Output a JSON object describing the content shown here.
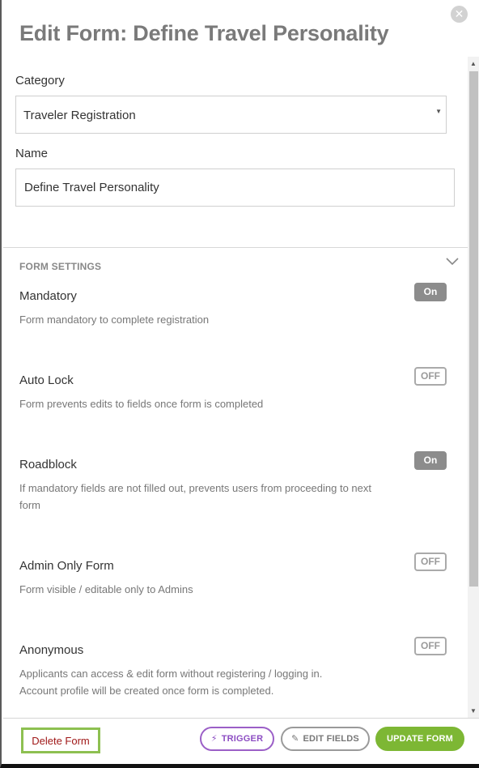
{
  "title": "Edit Form: Define Travel Personality",
  "form": {
    "category_label": "Category",
    "category_value": "Traveler Registration",
    "name_label": "Name",
    "name_value": "Define Travel Personality"
  },
  "settings": {
    "heading": "FORM SETTINGS",
    "items": [
      {
        "title": "Mandatory",
        "desc": "Form mandatory to complete registration",
        "state": "On"
      },
      {
        "title": "Auto Lock",
        "desc": "Form prevents edits to fields once form is completed",
        "state": "OFF"
      },
      {
        "title": "Roadblock",
        "desc": "If mandatory fields are not filled out, prevents users from proceeding to next form",
        "state": "On"
      },
      {
        "title": "Admin Only Form",
        "desc": "Form visible / editable only to Admins",
        "state": "OFF"
      },
      {
        "title": "Anonymous",
        "desc_line1": "Applicants can access & edit form without registering / logging in.",
        "desc_line2": "Account profile will be created once form is completed.",
        "state": "OFF"
      }
    ]
  },
  "footer": {
    "delete_label": "Delete Form",
    "trigger_label": "TRIGGER",
    "edit_fields_label": "EDIT FIELDS",
    "update_label": "UPDATE FORM"
  },
  "colors": {
    "title": "#7a7a7a",
    "delete_text": "#a01818",
    "delete_border": "#8dc051",
    "trigger": "#8d4ec3",
    "update_bg": "#7db734",
    "toggle_on_bg": "#8c8c8c"
  },
  "icons": {
    "close": "close-icon",
    "dropdown": "caret-down-icon",
    "collapse": "chevron-down-icon",
    "trigger": "lightning-icon",
    "edit": "pencil-icon"
  }
}
